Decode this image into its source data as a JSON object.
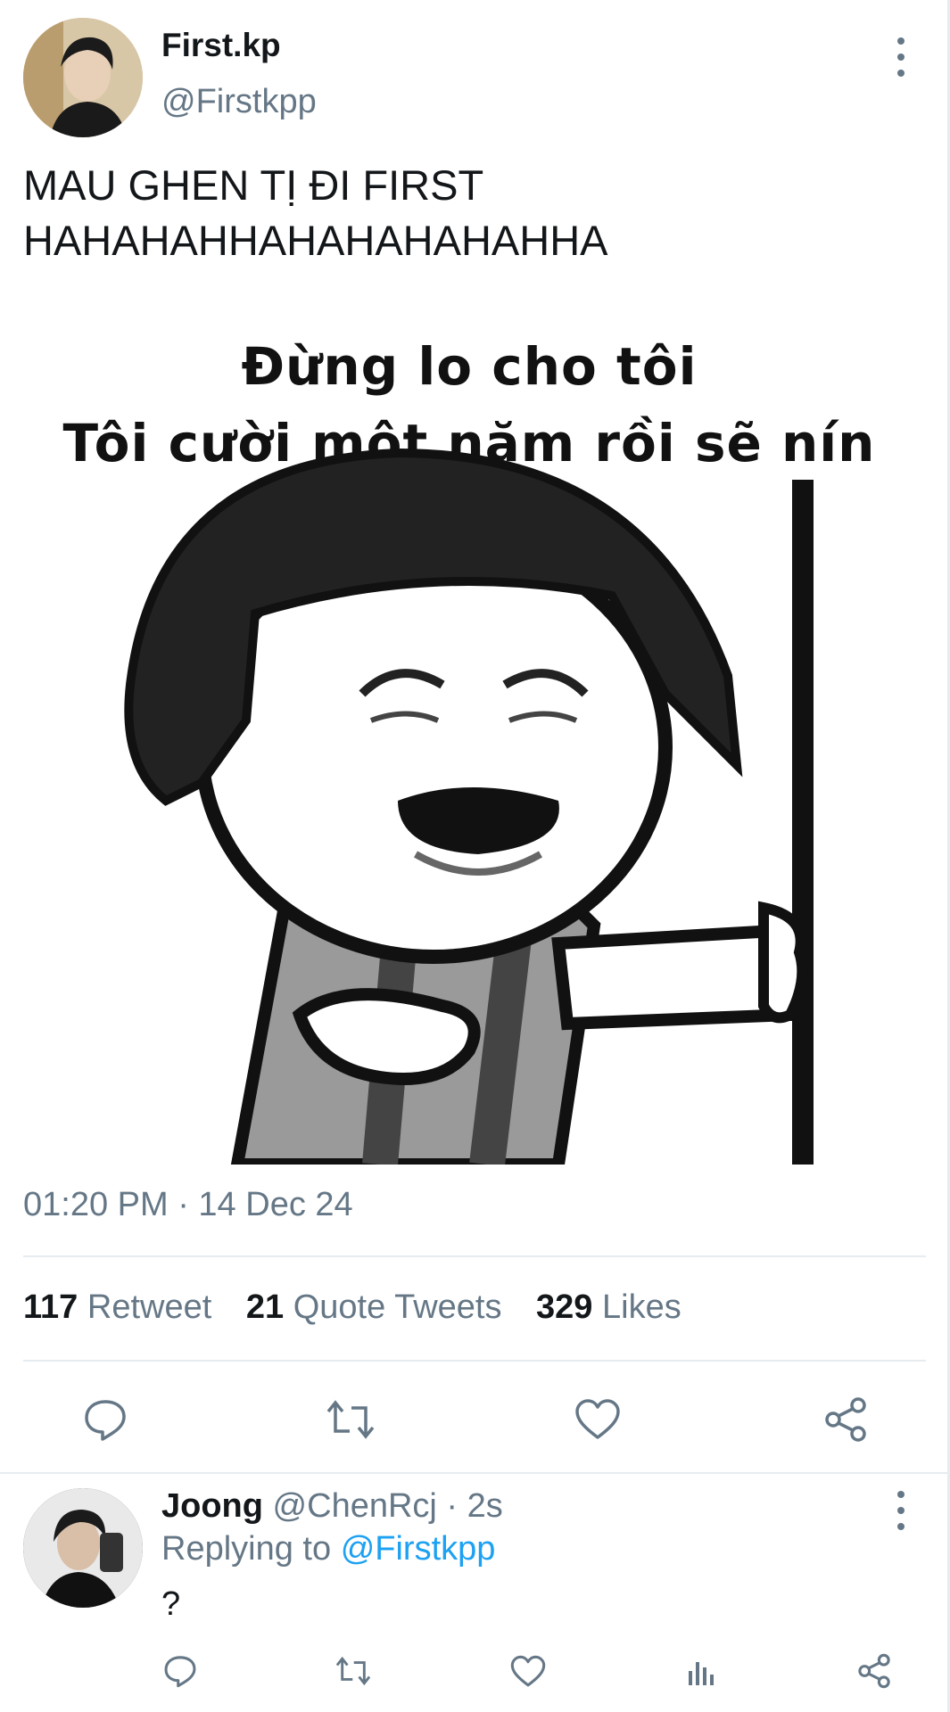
{
  "author": {
    "display_name": "First.kp",
    "handle": "@Firstkpp"
  },
  "tweet": {
    "text_line1": "MAU GHEN TỊ ĐI FIRST",
    "text_line2": "HAHAHAHHAHAHAHAHAHHA",
    "media": {
      "caption_line1": "Đừng lo cho tôi",
      "caption_line2": "Tôi cười một năm rồi sẽ nín"
    },
    "timestamp": "01:20 PM · 14 Dec 24"
  },
  "stats": {
    "retweets_count": "117",
    "retweets_label": "Retweet",
    "quotes_count": "21",
    "quotes_label": "Quote Tweets",
    "likes_count": "329",
    "likes_label": "Likes"
  },
  "actions": [
    "reply-icon",
    "retweet-icon",
    "like-icon",
    "share-icon"
  ],
  "reply": {
    "name": "Joong",
    "meta": "@ChenRcj · 2s",
    "replying_prefix": "Replying to",
    "replying_to": "@Firstkpp",
    "text": "?",
    "actions": [
      "reply-icon",
      "retweet-icon",
      "like-icon",
      "analytics-icon",
      "share-icon"
    ]
  },
  "colors": {
    "text_primary": "#14171a",
    "text_secondary": "#657786",
    "link": "#1da1f2",
    "divider": "#e6ecf0"
  }
}
